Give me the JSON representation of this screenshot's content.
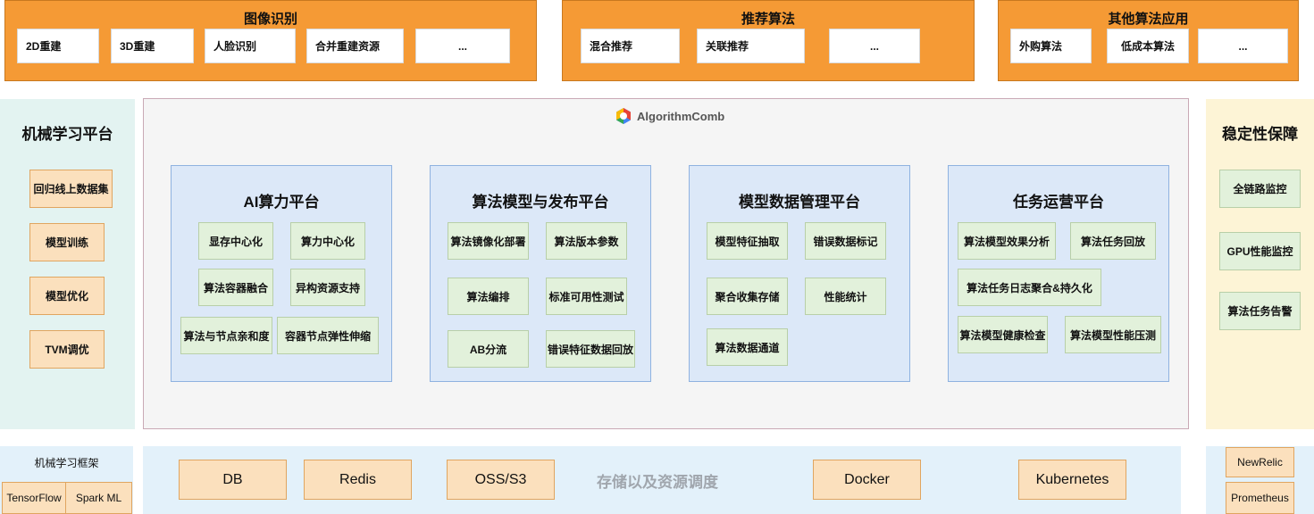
{
  "top_groups": [
    {
      "title": "图像识别",
      "items": [
        "2D重建",
        "3D重建",
        "人脸识别",
        "合并重建资源",
        "..."
      ]
    },
    {
      "title": "推荐算法",
      "items": [
        "混合推荐",
        "关联推荐",
        "..."
      ]
    },
    {
      "title": "其他算法应用",
      "items": [
        "外购算法",
        "低成本算法",
        "..."
      ]
    }
  ],
  "left_panel": {
    "title": "机械学习平台",
    "items": [
      "回归线上数据集",
      "模型训练",
      "模型优化",
      "TVM调优"
    ]
  },
  "right_panel": {
    "title": "稳定性保障",
    "items": [
      "全链路监控",
      "GPU性能监控",
      "算法任务告警"
    ]
  },
  "main": {
    "brand": "AlgorithmComb",
    "platforms": [
      {
        "title": "AI算力平台",
        "items": [
          "显存中心化",
          "算力中心化",
          "算法容器融合",
          "异构资源支持",
          "算法与节点亲和度",
          "容器节点弹性伸缩"
        ]
      },
      {
        "title": "算法模型与发布平台",
        "items": [
          "算法镜像化部署",
          "算法版本参数",
          "算法编排",
          "标准可用性测试",
          "AB分流",
          "错误特征数据回放"
        ]
      },
      {
        "title": "模型数据管理平台",
        "items": [
          "模型特征抽取",
          "错误数据标记",
          "聚合收集存储",
          "性能统计",
          "算法数据通道"
        ]
      },
      {
        "title": "任务运营平台",
        "items": [
          "算法模型效果分析",
          "算法任务回放",
          "算法任务日志聚合&持久化",
          "算法模型健康检查",
          "算法模型性能压测"
        ]
      }
    ]
  },
  "bottom": {
    "framework": {
      "title": "机械学习框架",
      "items": [
        "TensorFlow",
        "Spark ML"
      ]
    },
    "resources": [
      "DB",
      "Redis",
      "OSS/S3",
      "Docker",
      "Kubernetes"
    ],
    "storage_label": "存储以及资源调度",
    "monitoring": [
      "NewRelic",
      "Prometheus"
    ]
  }
}
